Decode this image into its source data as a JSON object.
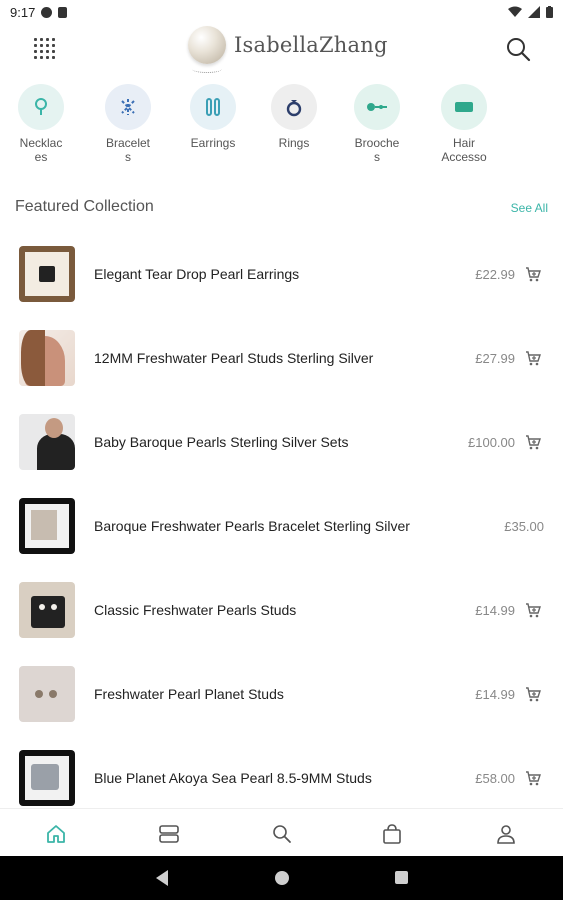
{
  "status_bar": {
    "time": "9:17"
  },
  "header": {
    "brand": "IsabellaZhang"
  },
  "categories": [
    {
      "label": "Necklac\nes",
      "icon": "necklace-icon",
      "color": "#3bb5a8"
    },
    {
      "label": "Bracelet\ns",
      "icon": "bracelet-icon",
      "color": "#3b6fb5"
    },
    {
      "label": "Earrings",
      "icon": "earrings-icon",
      "color": "#3b9fb5"
    },
    {
      "label": "Rings",
      "icon": "ring-icon",
      "color": "#2c3e6b"
    },
    {
      "label": "Brooche\ns",
      "icon": "brooch-icon",
      "color": "#2fa88c"
    },
    {
      "label": "Hair\nAccesso",
      "icon": "hair-accessory-icon",
      "color": "#2fa88c"
    }
  ],
  "featured": {
    "title": "Featured Collection",
    "see_all": "See All"
  },
  "products": [
    {
      "name": "Elegant Tear Drop Pearl Earrings",
      "price": "£22.99",
      "has_cart": true
    },
    {
      "name": "12MM Freshwater Pearl Studs Sterling Silver",
      "price": "£27.99",
      "has_cart": true
    },
    {
      "name": "Baby Baroque Pearls Sterling Silver Sets",
      "price": "£100.00",
      "has_cart": true
    },
    {
      "name": "Baroque Freshwater Pearls Bracelet Sterling Silver",
      "price": "£35.00",
      "has_cart": false
    },
    {
      "name": "Classic Freshwater Pearls Studs",
      "price": "£14.99",
      "has_cart": true
    },
    {
      "name": "Freshwater Pearl Planet Studs",
      "price": "£14.99",
      "has_cart": true
    },
    {
      "name": "Blue Planet Akoya Sea Pearl 8.5-9MM Studs",
      "price": "£58.00",
      "has_cart": true
    }
  ],
  "bottom_nav": [
    {
      "icon": "home-icon",
      "active": true
    },
    {
      "icon": "categories-icon",
      "active": false
    },
    {
      "icon": "search-icon",
      "active": false
    },
    {
      "icon": "bag-icon",
      "active": false
    },
    {
      "icon": "profile-icon",
      "active": false
    }
  ],
  "colors": {
    "accent": "#3bb5a8",
    "text": "#222222",
    "muted": "#888888"
  }
}
